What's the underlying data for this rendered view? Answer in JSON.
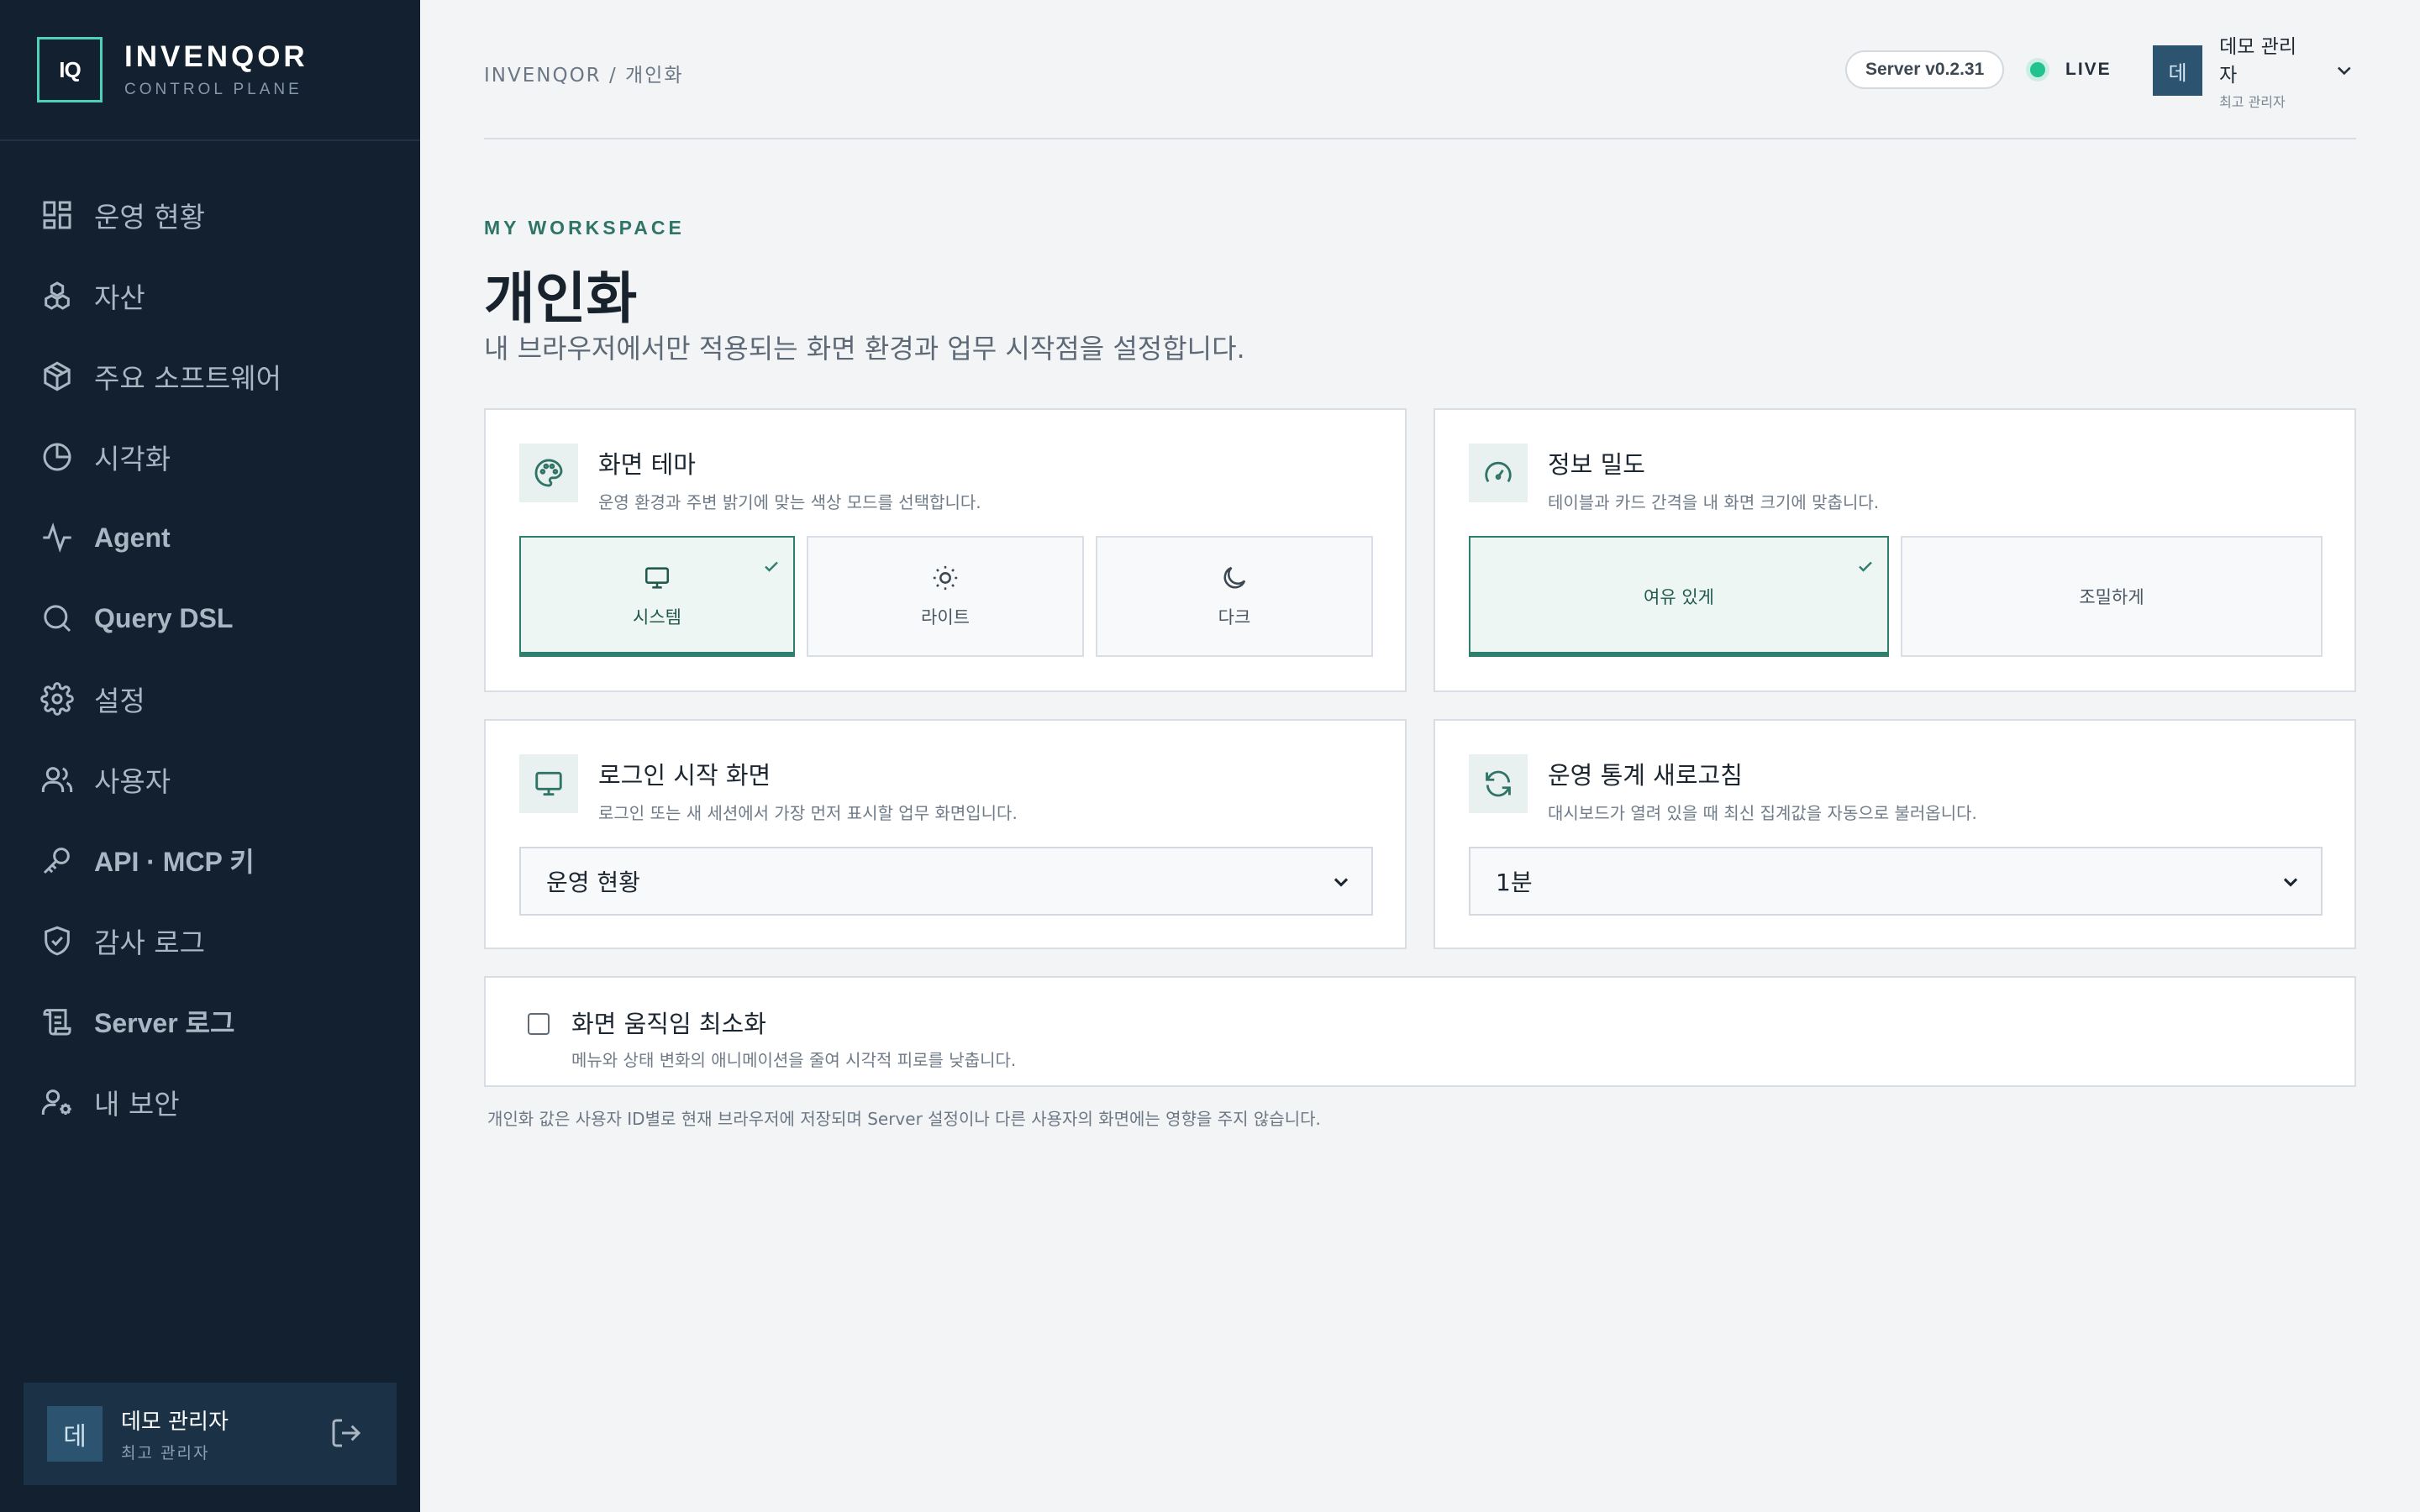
{
  "brand": {
    "logo": "IQ",
    "name": "INVENQOR",
    "sub": "CONTROL PLANE"
  },
  "nav": [
    {
      "label": "운영 현황",
      "icon": "dashboard-icon"
    },
    {
      "label": "자산",
      "icon": "cubes-icon"
    },
    {
      "label": "주요 소프트웨어",
      "icon": "package-icon"
    },
    {
      "label": "시각화",
      "icon": "pie-chart-icon"
    },
    {
      "label": "Agent",
      "icon": "activity-icon"
    },
    {
      "label": "Query DSL",
      "icon": "search-icon"
    },
    {
      "label": "설정",
      "icon": "gear-icon"
    },
    {
      "label": "사용자",
      "icon": "users-icon"
    },
    {
      "label": "API · MCP 키",
      "icon": "key-icon"
    },
    {
      "label": "감사 로그",
      "icon": "shield-check-icon"
    },
    {
      "label": "Server 로그",
      "icon": "scroll-icon"
    },
    {
      "label": "내 보안",
      "icon": "user-cog-icon"
    }
  ],
  "sidebar_user": {
    "avatar": "데",
    "name": "데모 관리자",
    "role": "최고 관리자"
  },
  "topbar": {
    "breadcrumb": "INVENQOR / 개인화",
    "server_version": "Server v0.2.31",
    "live": "LIVE",
    "user": {
      "avatar": "데",
      "name": "데모 관리자",
      "role": "최고 관리자"
    }
  },
  "page": {
    "eyebrow": "MY WORKSPACE",
    "title": "개인화",
    "description": "내 브라우저에서만 적용되는 화면 환경과 업무 시작점을 설정합니다."
  },
  "theme": {
    "title": "화면 테마",
    "sub": "운영 환경과 주변 밝기에 맞는 색상 모드를 선택합니다.",
    "options": [
      {
        "label": "시스템",
        "icon": "monitor-icon",
        "selected": true
      },
      {
        "label": "라이트",
        "icon": "sun-icon",
        "selected": false
      },
      {
        "label": "다크",
        "icon": "moon-icon",
        "selected": false
      }
    ]
  },
  "density": {
    "title": "정보 밀도",
    "sub": "테이블과 카드 간격을 내 화면 크기에 맞춥니다.",
    "options": [
      {
        "label": "여유 있게",
        "selected": true
      },
      {
        "label": "조밀하게",
        "selected": false
      }
    ]
  },
  "login_start": {
    "title": "로그인 시작 화면",
    "sub": "로그인 또는 새 세션에서 가장 먼저 표시할 업무 화면입니다.",
    "value": "운영 현황"
  },
  "refresh": {
    "title": "운영 통계 새로고침",
    "sub": "대시보드가 열려 있을 때 최신 집계값을 자동으로 불러옵니다.",
    "value": "1분"
  },
  "reduce_motion": {
    "title": "화면 움직임 최소화",
    "sub": "메뉴와 상태 변화의 애니메이션을 줄여 시각적 피로를 낮춥니다.",
    "checked": false
  },
  "footnote": "개인화 값은 사용자 ID별로 현재 브라우저에 저장되며 Server 설정이나 다른 사용자의 화면에는 영향을 주지 않습니다.",
  "colors": {
    "sidebar_bg": "#12202f",
    "accent": "#2f7f6f",
    "live": "#22c38e"
  }
}
